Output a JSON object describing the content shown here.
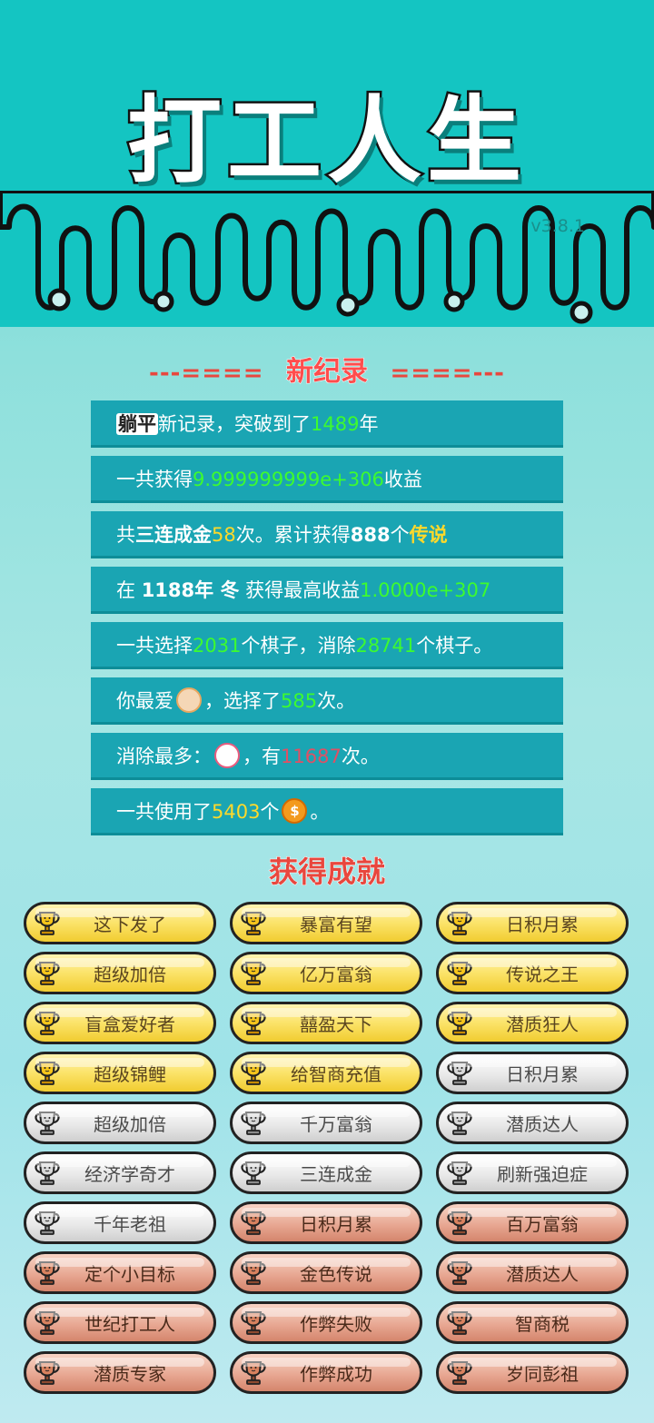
{
  "app": {
    "title": "打工人生",
    "version": "v3.8.1"
  },
  "new_record_section": {
    "left_deco": "---====",
    "heading": "新纪录",
    "right_deco": "====---"
  },
  "records": [
    {
      "parts": [
        {
          "t": "躺平",
          "s": "tag"
        },
        {
          "t": "新记录，突破到了"
        },
        {
          "t": "1489",
          "s": "g"
        },
        {
          "t": "年"
        }
      ]
    },
    {
      "parts": [
        {
          "t": "一共获得"
        },
        {
          "t": "9.999999999e+306",
          "s": "g"
        },
        {
          "t": "收益"
        }
      ]
    },
    {
      "parts": [
        {
          "t": "共"
        },
        {
          "t": "三连成金",
          "s": "b"
        },
        {
          "t": "58",
          "s": "y"
        },
        {
          "t": "次。累计获得"
        },
        {
          "t": "888",
          "s": "b"
        },
        {
          "t": "个"
        },
        {
          "t": "传说",
          "s": "y b"
        }
      ]
    },
    {
      "parts": [
        {
          "t": "在 "
        },
        {
          "t": "1188年 冬",
          "s": "b"
        },
        {
          "t": " 获得最高收益"
        },
        {
          "t": "1.0000e+307",
          "s": "g"
        }
      ]
    },
    {
      "parts": [
        {
          "t": "一共选择"
        },
        {
          "t": "2031",
          "s": "g"
        },
        {
          "t": "个棋子，消除"
        },
        {
          "t": "28741",
          "s": "g"
        },
        {
          "t": "个棋子。"
        }
      ]
    },
    {
      "parts": [
        {
          "t": "你最爱"
        },
        {
          "icon": "face"
        },
        {
          "t": "，选择了"
        },
        {
          "t": "585",
          "s": "g"
        },
        {
          "t": "次。"
        }
      ]
    },
    {
      "parts": [
        {
          "t": "消除最多："
        },
        {
          "icon": "bowl"
        },
        {
          "t": "，有"
        },
        {
          "t": "11687",
          "s": "r"
        },
        {
          "t": "次。"
        }
      ]
    },
    {
      "parts": [
        {
          "t": "一共使用了"
        },
        {
          "t": "5403",
          "s": "y"
        },
        {
          "t": "个"
        },
        {
          "icon": "coin",
          "label": "$"
        },
        {
          "t": "。"
        }
      ]
    }
  ],
  "achievements_section": {
    "heading": "获得成就"
  },
  "achievements": [
    {
      "label": "这下发了",
      "tier": "gold"
    },
    {
      "label": "暴富有望",
      "tier": "gold"
    },
    {
      "label": "日积月累",
      "tier": "gold"
    },
    {
      "label": "超级加倍",
      "tier": "gold"
    },
    {
      "label": "亿万富翁",
      "tier": "gold"
    },
    {
      "label": "传说之王",
      "tier": "gold"
    },
    {
      "label": "盲盒爱好者",
      "tier": "gold"
    },
    {
      "label": "囍盈天下",
      "tier": "gold"
    },
    {
      "label": "潜质狂人",
      "tier": "gold"
    },
    {
      "label": "超级锦鲤",
      "tier": "gold"
    },
    {
      "label": "给智商充值",
      "tier": "gold"
    },
    {
      "label": "日积月累",
      "tier": "silver"
    },
    {
      "label": "超级加倍",
      "tier": "silver"
    },
    {
      "label": "千万富翁",
      "tier": "silver"
    },
    {
      "label": "潜质达人",
      "tier": "silver"
    },
    {
      "label": "经济学奇才",
      "tier": "silver"
    },
    {
      "label": "三连成金",
      "tier": "silver"
    },
    {
      "label": "刷新强迫症",
      "tier": "silver"
    },
    {
      "label": "千年老祖",
      "tier": "silver"
    },
    {
      "label": "日积月累",
      "tier": "bronze"
    },
    {
      "label": "百万富翁",
      "tier": "bronze"
    },
    {
      "label": "定个小目标",
      "tier": "bronze"
    },
    {
      "label": "金色传说",
      "tier": "bronze"
    },
    {
      "label": "潜质达人",
      "tier": "bronze"
    },
    {
      "label": "世纪打工人",
      "tier": "bronze"
    },
    {
      "label": "作弊失败",
      "tier": "bronze"
    },
    {
      "label": "智商税",
      "tier": "bronze"
    },
    {
      "label": "潜质专家",
      "tier": "bronze"
    },
    {
      "label": "作弊成功",
      "tier": "bronze"
    },
    {
      "label": "岁同彭祖",
      "tier": "bronze"
    }
  ],
  "colors": {
    "header_bg": "#14c5c2",
    "record_bg": "#1aa5b3",
    "highlight_green": "#3dfb2f",
    "highlight_yellow": "#ffd92a",
    "highlight_red": "#e05064",
    "heading_red": "#e8473e"
  },
  "icons": {
    "trophy": "trophy-icon",
    "face": "old-man-face-icon",
    "bowl": "noodle-bowl-icon",
    "coin": "coin-icon"
  }
}
